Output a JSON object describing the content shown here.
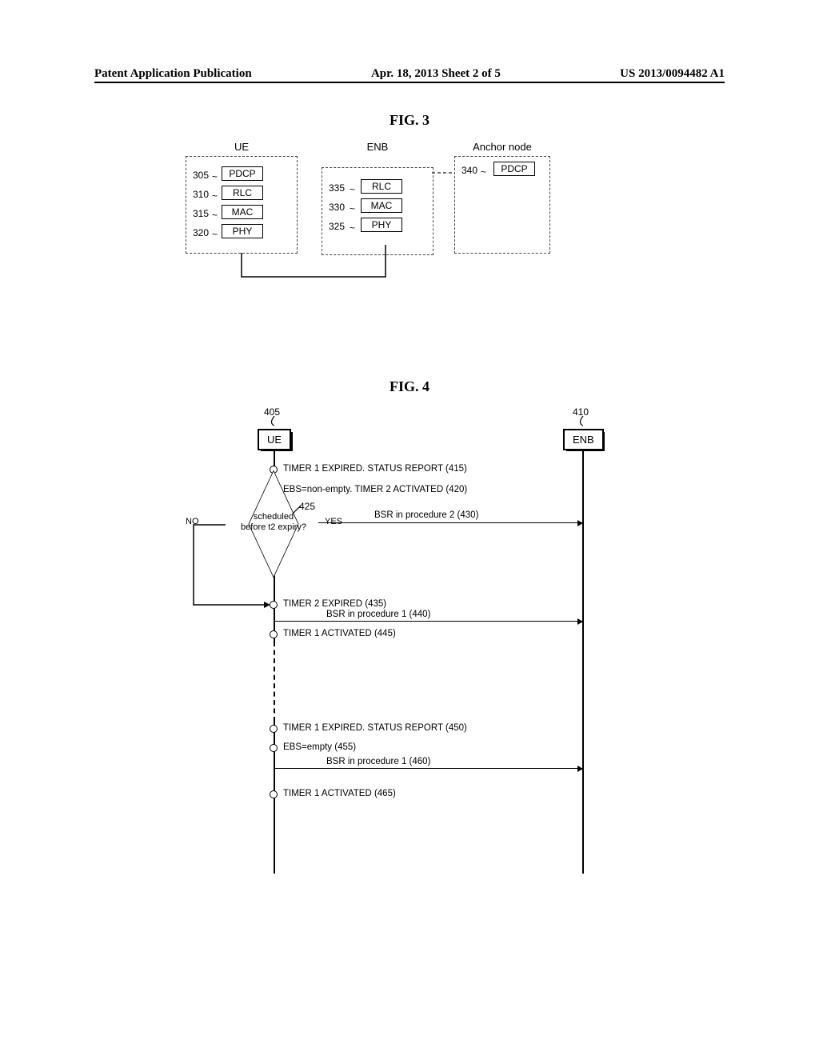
{
  "header": {
    "left": "Patent Application Publication",
    "center": "Apr. 18, 2013  Sheet 2 of 5",
    "right": "US 2013/0094482 A1"
  },
  "fig3": {
    "title": "FIG. 3",
    "ue": {
      "title": "UE",
      "layers": [
        {
          "ref": "305",
          "name": "PDCP"
        },
        {
          "ref": "310",
          "name": "RLC"
        },
        {
          "ref": "315",
          "name": "MAC"
        },
        {
          "ref": "320",
          "name": "PHY"
        }
      ]
    },
    "enb": {
      "title": "ENB",
      "layers": [
        {
          "ref": "335",
          "name": "RLC"
        },
        {
          "ref": "330",
          "name": "MAC"
        },
        {
          "ref": "325",
          "name": "PHY"
        }
      ]
    },
    "anchor": {
      "title": "Anchor node",
      "layers": [
        {
          "ref": "340",
          "name": "PDCP"
        }
      ]
    }
  },
  "fig4": {
    "title": "FIG. 4",
    "lanes": {
      "ue": {
        "ref": "405",
        "label": "UE"
      },
      "enb": {
        "ref": "410",
        "label": "ENB"
      }
    },
    "events": {
      "e415": "TIMER 1 EXPIRED. STATUS REPORT (415)",
      "e420": "EBS=non-empty. TIMER 2 ACTIVATED (420)",
      "e435": "TIMER 2 EXPIRED (435)",
      "e445": "TIMER 1 ACTIVATED (445)",
      "e450": "TIMER 1 EXPIRED. STATUS REPORT  (450)",
      "e455": "EBS=empty (455)",
      "e465": "TIMER 1 ACTIVATED (465)"
    },
    "msgs": {
      "m430": "BSR in procedure 2 (430)",
      "m440": "BSR in procedure 1 (440)",
      "m460": "BSR in procedure 1 (460)"
    },
    "decision": {
      "ref": "425",
      "text_l1": "scheduled",
      "text_l2": "before t2 expiry?",
      "yes": "YES",
      "no": "NO"
    }
  }
}
